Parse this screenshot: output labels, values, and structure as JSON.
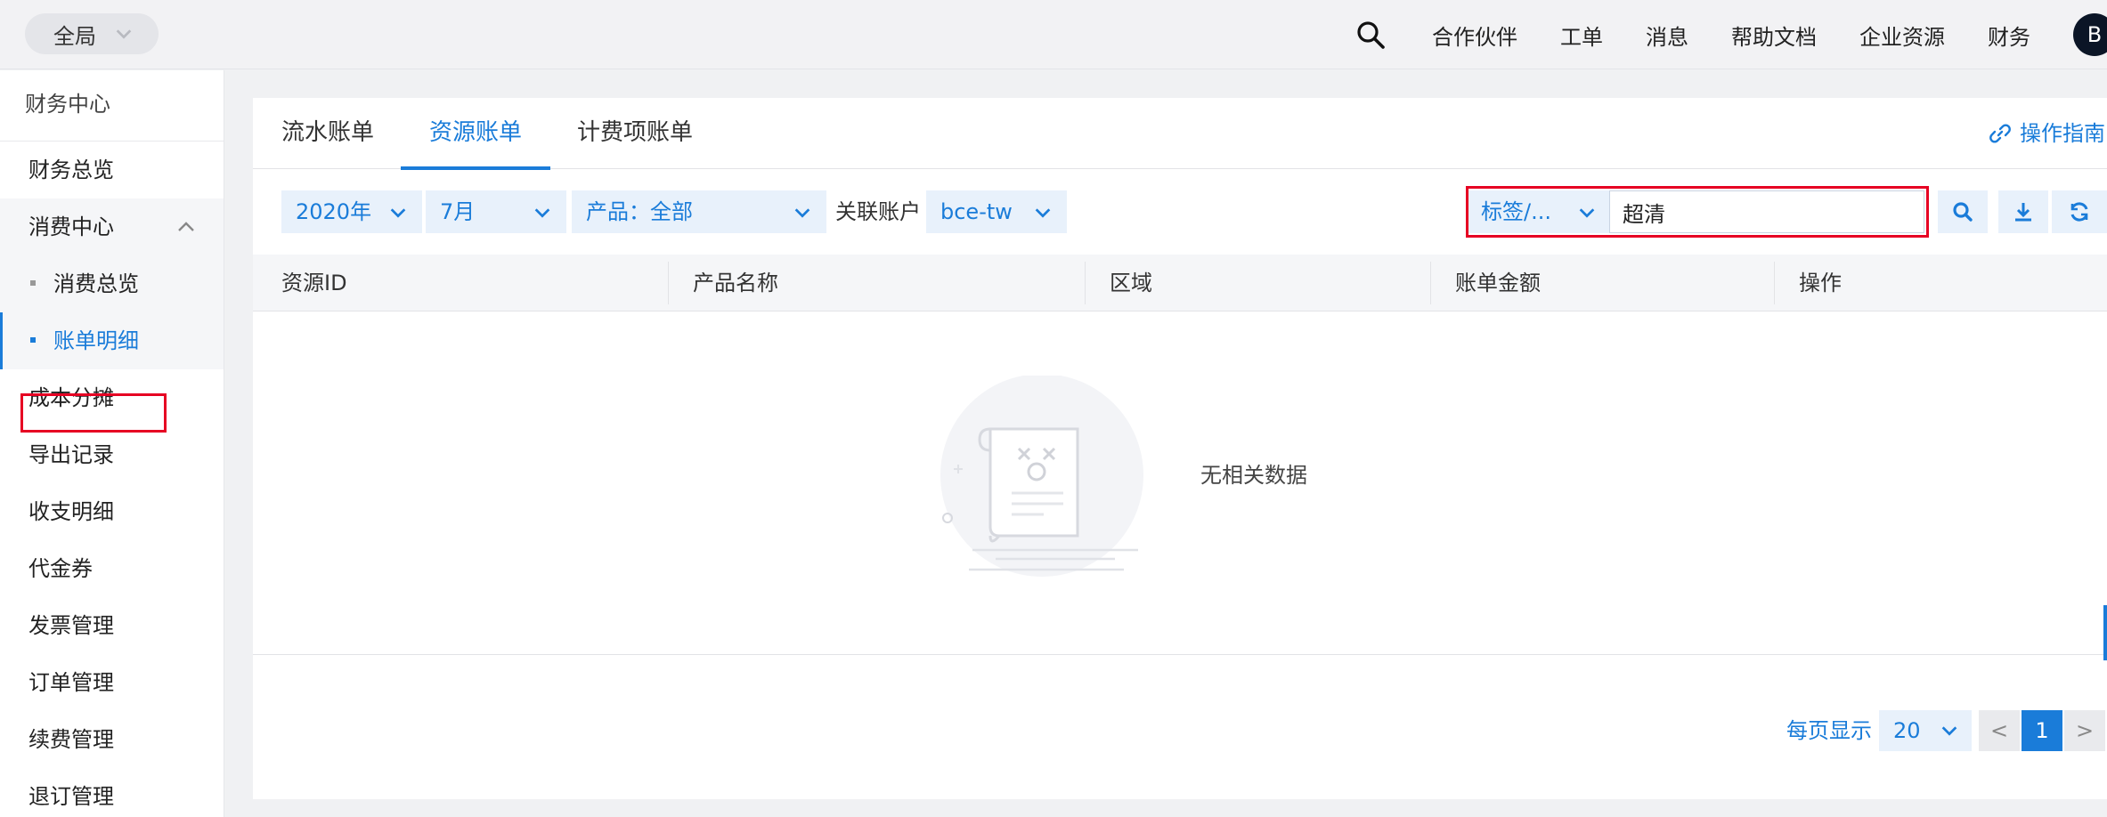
{
  "topbar": {
    "scope": "全局",
    "nav": [
      "合作伙伴",
      "工单",
      "消息",
      "帮助文档",
      "企业资源",
      "财务"
    ],
    "avatar": "B",
    "icons": {
      "search": "search-icon",
      "scope_dropdown": "chevron-down-icon"
    }
  },
  "sidebar": {
    "title": "财务中心",
    "items": {
      "overview": "财务总览",
      "consume": "消费中心",
      "consume_overview": "消费总览",
      "bill_detail": "账单明细",
      "cost_split": "成本分摊",
      "export_log": "导出记录",
      "income_expense": "收支明细",
      "voucher": "代金券",
      "invoice": "发票管理",
      "order": "订单管理",
      "renewal": "续费管理",
      "refund": "退订管理"
    }
  },
  "tabs": [
    "流水账单",
    "资源账单",
    "计费项账单"
  ],
  "active_tab": "资源账单",
  "guide": "操作指南",
  "filters": {
    "year": "2020年",
    "month": "7月",
    "product": "产品：全部",
    "account_label": "关联账户",
    "account": "bce-tw",
    "tag_select": "标签/...",
    "tag_value": "超清"
  },
  "table": {
    "columns": [
      "资源ID",
      "产品名称",
      "区域",
      "账单金额",
      "操作"
    ],
    "empty_text": "无相关数据"
  },
  "pagination": {
    "label": "每页显示",
    "page_size": "20",
    "prev": "<",
    "current": "1",
    "next": ">"
  },
  "colors": {
    "accent": "#1a7cd9",
    "highlight": "#e60023"
  }
}
